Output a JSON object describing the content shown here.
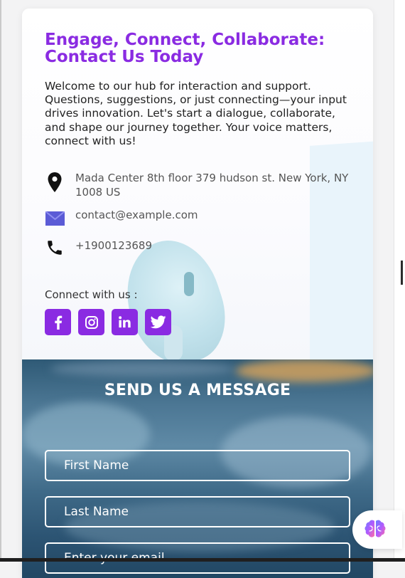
{
  "contact": {
    "title": "Engage, Connect, Collaborate: Contact Us Today",
    "intro": "Welcome to our hub for interaction and support. Questions, suggestions, or just connecting—your input drives innovation. Let's start a dialogue, collaborate, and shape our journey together. Your voice matters, connect with us!",
    "address": "Mada Center 8th floor 379 hudson st. New York, NY 1008 US",
    "email": "contact@example.com",
    "phone": "+1900123689",
    "connect_label": "Connect with us :",
    "socials": [
      {
        "icon": "facebook-icon"
      },
      {
        "icon": "instagram-icon"
      },
      {
        "icon": "linkedin-icon"
      },
      {
        "icon": "twitter-icon"
      }
    ]
  },
  "form": {
    "title": "SEND US A MESSAGE",
    "first_name_placeholder": "First Name",
    "last_name_placeholder": "Last Name",
    "email_placeholder": "Enter your email"
  },
  "colors": {
    "accent": "#8a2be2",
    "form_text": "#ffffff"
  },
  "assistant": {
    "icon": "brain-icon"
  }
}
